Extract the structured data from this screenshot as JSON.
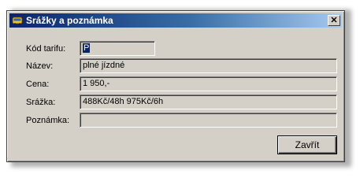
{
  "window": {
    "title": "Srážky a poznámka",
    "close_glyph": "✕"
  },
  "form": {
    "kod_tarifu": {
      "label": "Kód tarifu:",
      "value": "P"
    },
    "nazev": {
      "label": "Název:",
      "value": "plné jízdné"
    },
    "cena": {
      "label": "Cena:",
      "value": "1 950,-"
    },
    "srazka": {
      "label": "Srážka:",
      "value": "488Kč/48h 975Kč/6h"
    },
    "poznamka": {
      "label": "Poznámka:",
      "value": ""
    }
  },
  "buttons": {
    "close_label": "Zavřít"
  }
}
